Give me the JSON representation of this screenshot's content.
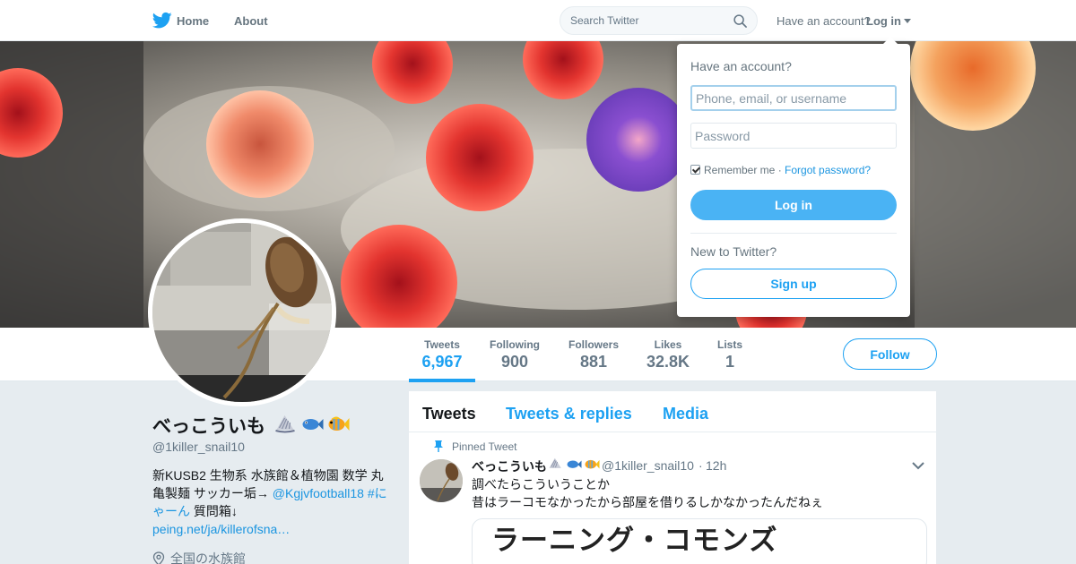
{
  "nav": {
    "home_label": "Home",
    "about_label": "About",
    "search_placeholder": "Search Twitter",
    "have_account": "Have an account?",
    "login_label": "Log in",
    "brand_color": "#1da1f2"
  },
  "profile_nav": {
    "stats": [
      {
        "label": "Tweets",
        "value": "6,967"
      },
      {
        "label": "Following",
        "value": "900"
      },
      {
        "label": "Followers",
        "value": "881"
      },
      {
        "label": "Likes",
        "value": "32.8K"
      },
      {
        "label": "Lists",
        "value": "1"
      }
    ],
    "follow_label": "Follow"
  },
  "profile": {
    "name": "べっこういも",
    "name_emojis": [
      "spiral-shell-icon",
      "fish-icon",
      "tropical-fish-icon"
    ],
    "handle": "@1killer_snail10",
    "bio_text": "新KUSB2 生物系 水族館＆植物園 数学 丸亀製麺 サッカー垢→ ",
    "bio_link1": "@Kgjvfootball18 #にゃーん",
    "bio_text2": " 質問箱↓",
    "bio_link2": "peing.net/ja/killerofsna…",
    "location": "全国の水族館"
  },
  "timeline": {
    "tabs": [
      "Tweets",
      "Tweets & replies",
      "Media"
    ],
    "pinned_label": "Pinned Tweet",
    "tweet": {
      "name": "べっこういも",
      "handle": "@1killer_snail10",
      "dot": "·",
      "time": "12h",
      "line1": "調べたらこういうことか",
      "line2": "昔はラーコモなかったから部屋を借りるしかなかったんだねぇ",
      "card_text": "ラーニング・コモンズ"
    }
  },
  "login_dropdown": {
    "title": "Have an account?",
    "username_placeholder": "Phone, email, or username",
    "password_placeholder": "Password",
    "remember_label": "Remember me",
    "separator": " · ",
    "forgot_label": "Forgot password?",
    "login_button": "Log in",
    "new_label": "New to Twitter?",
    "signup_button": "Sign up"
  }
}
